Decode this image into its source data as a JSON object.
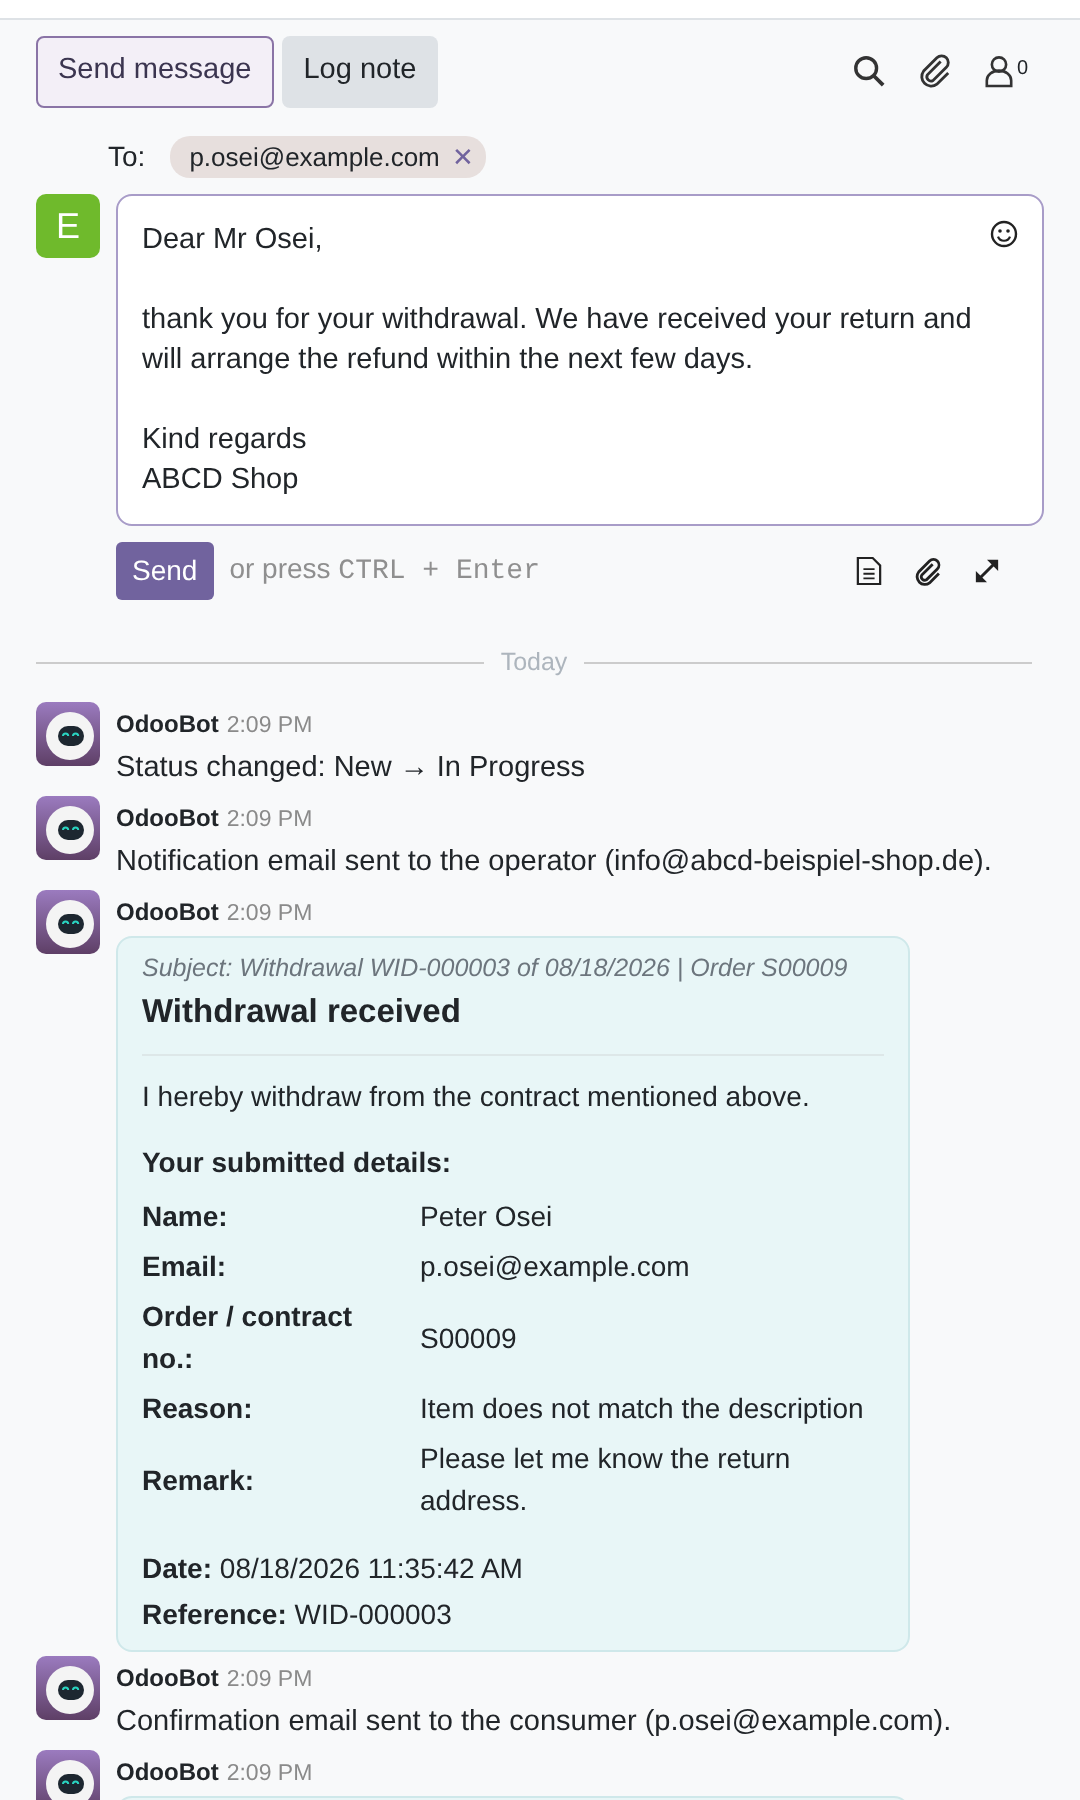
{
  "composer": {
    "tabs": [
      {
        "label": "Send message",
        "selected": true
      },
      {
        "label": "Log note",
        "selected": false
      }
    ],
    "follower_count": "0",
    "to_label": "To:",
    "recipients": [
      {
        "label": "p.osei@example.com",
        "remove": "✕"
      }
    ],
    "avatar_letter": "E",
    "paragraphs": [
      [
        "Dear Mr Osei,"
      ],
      [
        "thank you for your withdrawal. We have received your return and",
        "will arrange the refund within the next few days."
      ],
      [
        "Kind regards",
        "ABCD Shop"
      ]
    ],
    "send_label": "Send",
    "hint": "or press",
    "hint_keys": "CTRL + Enter"
  },
  "separator": "Today",
  "messages": [
    {
      "kind": "note",
      "author": "OdooBot",
      "time": "2:09 PM",
      "text": "Status changed: New → In Progress"
    },
    {
      "kind": "note",
      "author": "OdooBot",
      "time": "2:09 PM",
      "text": "Notification email sent to the operator (info@abcd-beispiel-shop.de)."
    },
    {
      "kind": "email",
      "author": "OdooBot",
      "time": "2:09 PM",
      "subject": "Subject: Withdrawal WID-000003 of 08/18/2026 | Order S00009",
      "title": "Withdrawal received",
      "intro": "I hereby withdraw from the contract mentioned above.",
      "details_heading": "Your submitted details:",
      "details": [
        {
          "label": "Name:",
          "value": "Peter Osei"
        },
        {
          "label": "Email:",
          "value": "p.osei@example.com"
        },
        {
          "label": "Order / contract no.:",
          "value": "S00009"
        },
        {
          "label": "Reason:",
          "value": "Item does not match the description"
        },
        {
          "label": "Remark:",
          "value": "Please let me know the return address."
        }
      ],
      "footer": [
        {
          "label": "Date:",
          "value": "08/18/2026 11:35:42 AM"
        },
        {
          "label": "Reference:",
          "value": "WID-000003"
        }
      ]
    },
    {
      "kind": "note",
      "author": "OdooBot",
      "time": "2:09 PM",
      "text": "Confirmation email sent to the consumer (p.osei@example.com)."
    },
    {
      "kind": "email_cut",
      "author": "OdooBot",
      "time": "2:09 PM"
    }
  ]
}
